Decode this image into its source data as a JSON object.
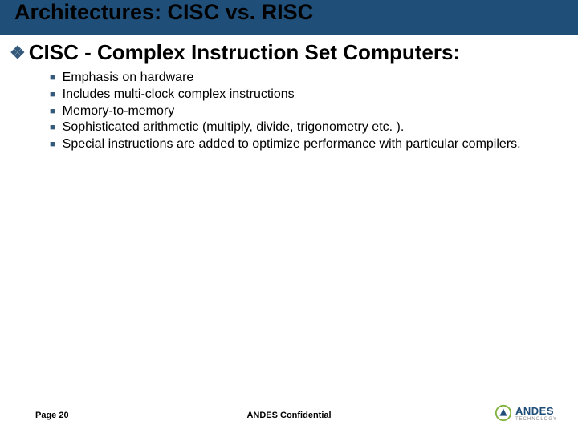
{
  "title": "Architectures: CISC vs. RISC",
  "heading": "CISC - Complex Instruction Set Computers:",
  "bullets": [
    "Emphasis on hardware",
    "Includes multi-clock complex instructions",
    "Memory-to-memory",
    "Sophisticated arithmetic (multiply, divide, trigonometry etc. ).",
    "Special instructions are added to optimize performance with particular compilers."
  ],
  "footer": {
    "page": "Page 20",
    "confidential": "ANDES Confidential",
    "logo_text": "ANDES",
    "logo_sub": "TECHNOLOGY"
  }
}
